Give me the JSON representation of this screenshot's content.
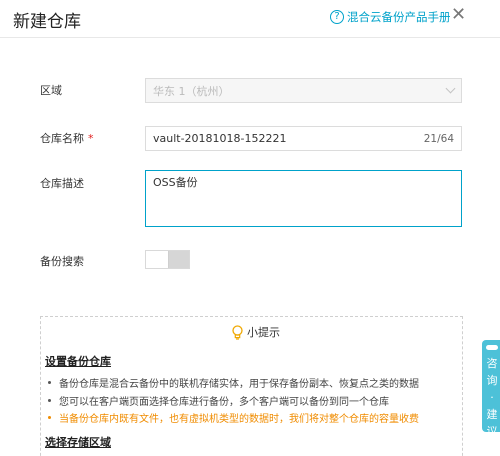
{
  "header": {
    "title": "新建仓库",
    "manual_link": "混合云备份产品手册",
    "close_icon": "close-icon"
  },
  "form": {
    "region": {
      "label": "区域",
      "value": "华东 1（杭州）"
    },
    "vault_name": {
      "label": "仓库名称",
      "required_mark": "*",
      "value": "vault-20181018-152221",
      "counter": "21/64"
    },
    "description": {
      "label": "仓库描述",
      "value": "OSS备份"
    },
    "backup_search": {
      "label": "备份搜索",
      "enabled": false
    }
  },
  "tips": {
    "title": "小提示",
    "section1_title": "设置备份仓库",
    "bullets": [
      "备份仓库是混合云备份中的联机存储实体，用于保存备份副本、恢复点之类的数据",
      "您可以在客户端页面选择仓库进行备份，多个客户端可以备份到同一个仓库",
      "当备份仓库内既有文件，也有虚拟机类型的数据时，我们将对整个仓库的容量收费"
    ],
    "section2_title": "选择存储区域"
  },
  "consult": {
    "chars": [
      "咨",
      "询",
      "·",
      "建",
      "议"
    ]
  },
  "colors": {
    "accent": "#00a2ca",
    "warning": "#f08c00",
    "required": "#e02020",
    "consult_bg": "#4dc1d8"
  }
}
